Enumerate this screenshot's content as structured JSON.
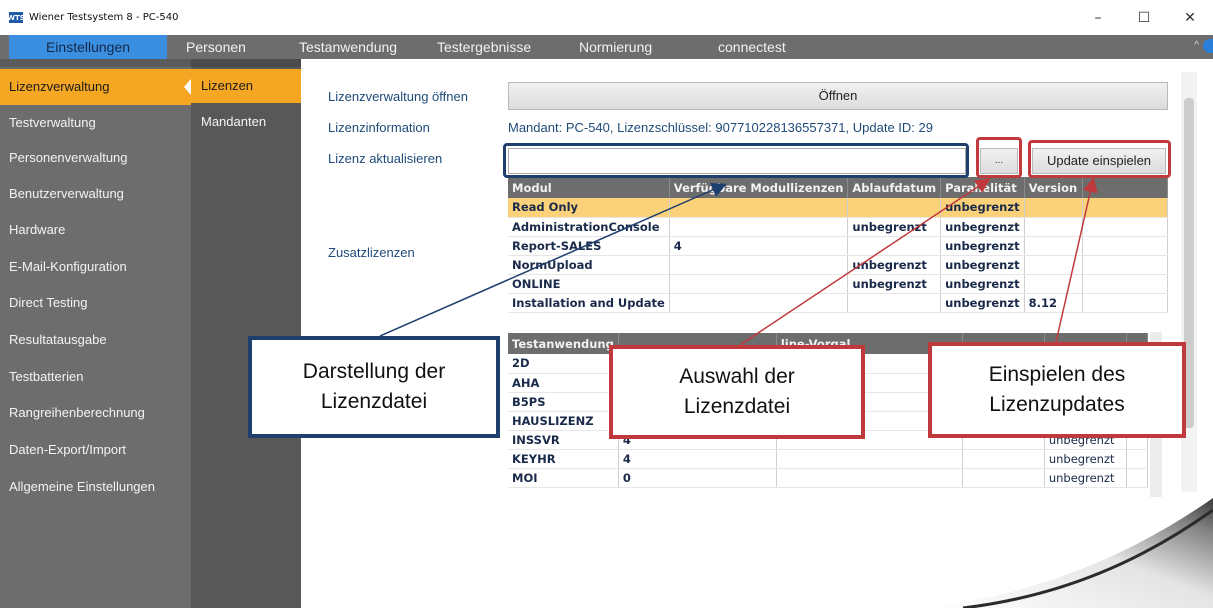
{
  "window": {
    "title": "Wiener Testsystem 8 - PC-540",
    "app_icon_text": "WTS",
    "minimize": "–",
    "maximize": "☐",
    "close": "✕"
  },
  "menu": {
    "items": [
      "Einstellungen",
      "Personen",
      "Testanwendung",
      "Testergebnisse",
      "Normierung",
      "connectest"
    ],
    "extra": "^"
  },
  "leftnav": {
    "items": [
      "Lizenzverwaltung",
      "Testverwaltung",
      "Personenverwaltung",
      "Benutzerverwaltung",
      "Hardware",
      "E-Mail-Konfiguration",
      "Direct Testing",
      "Resultatausgabe",
      "Testbatterien",
      "Rangreihenberechnung",
      "Daten-Export/Import",
      "Allgemeine Einstellungen"
    ]
  },
  "subnav": {
    "items": [
      "Lizenzen",
      "Mandanten"
    ]
  },
  "form": {
    "open_label": "Lizenzverwaltung öffnen",
    "open_button": "Öffnen",
    "info_label": "Lizenzinformation",
    "info_value": "Mandant: PC-540, Lizenzschlüssel: 907710228136557371, Update ID: 29",
    "update_label": "Lizenz aktualisieren",
    "license_path_value": "",
    "browse_button": "...",
    "update_button": "Update einspielen",
    "additional_label": "Zusatzlizenzen"
  },
  "modules_table": {
    "headers": [
      "Modul",
      "Verfügbare Modullizenzen",
      "Ablaufdatum",
      "Parallelität",
      "Version"
    ],
    "rows": [
      [
        "Read Only",
        "",
        "",
        "unbegrenzt",
        ""
      ],
      [
        "AdministrationConsole",
        "",
        "unbegrenzt",
        "unbegrenzt",
        ""
      ],
      [
        "Report-SALES",
        "4",
        "",
        "unbegrenzt",
        ""
      ],
      [
        "NormUpload",
        "",
        "unbegrenzt",
        "unbegrenzt",
        ""
      ],
      [
        "ONLINE",
        "",
        "unbegrenzt",
        "unbegrenzt",
        ""
      ],
      [
        "Installation and Update",
        "",
        "",
        "unbegrenzt",
        "8.12"
      ]
    ]
  },
  "tests_table": {
    "headers": [
      "Testanwendung",
      "",
      "line-Vorgal",
      "",
      ""
    ],
    "rows": [
      [
        "2D",
        "",
        "",
        "",
        ""
      ],
      [
        "AHA",
        "",
        "",
        "",
        ""
      ],
      [
        "B5PS",
        "",
        "",
        "",
        ""
      ],
      [
        "HAUSLIZENZ",
        "",
        "",
        "",
        ""
      ],
      [
        "INSSVR",
        "4",
        "",
        "",
        "unbegrenzt"
      ],
      [
        "KEYHR",
        "4",
        "",
        "",
        "unbegrenzt"
      ],
      [
        "MOI",
        "0",
        "",
        "",
        "unbegrenzt"
      ]
    ]
  },
  "callouts": {
    "display": "Darstellung der\nLizenzdatei",
    "select": "Auswahl der\nLizenzdatei",
    "install": "Einspielen des\nLizenzupdates"
  },
  "colors": {
    "accent_orange": "#f5a623",
    "menu_active_blue": "#3b8fe0",
    "sidebar_gray": "#6d6d6d",
    "callout_blue": "#1f3f6e",
    "callout_red": "#c0393d"
  }
}
